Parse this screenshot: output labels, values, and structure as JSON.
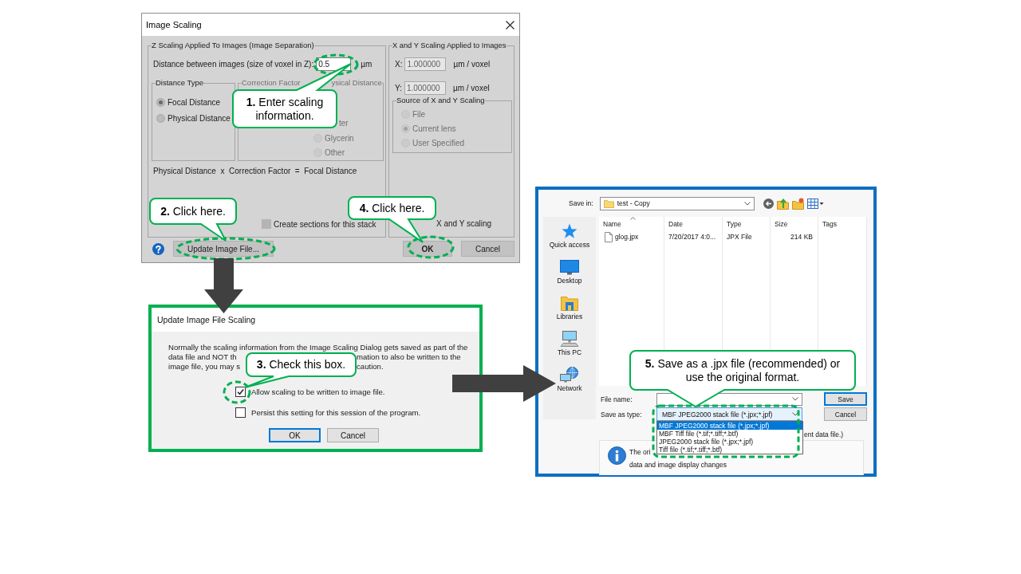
{
  "image_scaling_dialog": {
    "title": "Image Scaling",
    "z_scaling": {
      "legend": "Z Scaling Applied To Images (Image Separation)",
      "distance_label": "Distance between images (size of voxel in Z):",
      "distance_value": "0.5",
      "distance_unit": "µm",
      "distance_type": {
        "legend": "Distance Type",
        "options": [
          {
            "label": "Focal Distance",
            "selected": true,
            "disabled": false
          },
          {
            "label": "Physical Distance",
            "selected": false,
            "disabled": false
          }
        ]
      },
      "correction_factor": {
        "legend_parts": [
          "Correction Factor",
          "ysical Distance"
        ],
        "disabled": true,
        "covered_option_label": "ter",
        "options": [
          {
            "label": "Glycerin",
            "selected": false,
            "disabled": true
          },
          {
            "label": "Other",
            "selected": false,
            "disabled": true
          }
        ]
      },
      "formula": "Physical Distance  x  Correction Factor  =  Focal Distance",
      "create_sections": {
        "label": "Create sections for this stack",
        "checked": false
      }
    },
    "xy_scaling": {
      "legend": "X and Y Scaling Applied to Images",
      "fields": [
        {
          "label": "X:",
          "value": "1.000000",
          "unit": "µm / voxel"
        },
        {
          "label": "Y:",
          "value": "1.000000",
          "unit": "µm / voxel"
        }
      ],
      "source": {
        "legend": "Source of X and Y Scaling",
        "options": [
          {
            "label": "File",
            "selected": false,
            "disabled": true
          },
          {
            "label": "Current lens",
            "selected": true,
            "disabled": true
          },
          {
            "label": "User Specified",
            "selected": false,
            "disabled": true
          }
        ]
      },
      "partial_checkbox_label": "X and Y scaling"
    },
    "buttons": [
      {
        "label": "Update Image File...",
        "default": false
      },
      {
        "label": "OK",
        "default": true
      },
      {
        "label": "Cancel",
        "default": false
      }
    ]
  },
  "update_file_dialog": {
    "title": "Update Image File Scaling",
    "message_lines": [
      {
        "left": "Normally the scaling information from the Image Scaling Dialog gets saved as part of the"
      },
      {
        "left": "data file and NOT th",
        "right": "mation to also be written to the"
      },
      {
        "left": "image file, you may s",
        "right": "caution."
      }
    ],
    "checkboxes": [
      {
        "label": "Allow scaling to be written to image file.",
        "checked": true
      },
      {
        "label": "Persist this setting for this session of the program.",
        "checked": false
      }
    ],
    "buttons": [
      {
        "label": "OK",
        "default": true
      },
      {
        "label": "Cancel",
        "default": false
      }
    ]
  },
  "save_dialog": {
    "save_in_label": "Save in:",
    "save_in_value": "test - Copy",
    "places": [
      "Quick access",
      "Desktop",
      "Libraries",
      "This PC",
      "Network"
    ],
    "columns": [
      "Name",
      "Date",
      "Type",
      "Size",
      "Tags"
    ],
    "files": [
      {
        "name": "glog.jpx",
        "date": "7/20/2017 4:0...",
        "type": "JPX File",
        "size": "214 KB"
      }
    ],
    "file_name_label": "File name:",
    "save_type_label": "Save as type:",
    "save_type_value": "MBF JPEG2000 stack file (*.jpx;*.jpf)",
    "type_options": [
      {
        "label": "MBF JPEG2000 stack file (*.jpx;*.jpf)",
        "selected": true
      },
      {
        "label": "MBF Tiff file (*.tif;*.tiff;*.btf)",
        "selected": false
      },
      {
        "label": "JPEG2000 stack file (*.jpx;*.jpf)",
        "selected": false
      },
      {
        "label": "Tiff file (*.tif;*.tiff;*.btf)",
        "selected": false
      }
    ],
    "buttons": [
      {
        "label": "Save",
        "default": true
      },
      {
        "label": "Cancel",
        "default": false
      }
    ],
    "note_fragment": "ent data file.)",
    "info_fragments": [
      "The ori",
      "data and image display changes"
    ]
  },
  "callouts": [
    {
      "text": "**1.** Enter scaling information."
    },
    {
      "text": "**2.** Click here."
    },
    {
      "text": "**3.** Check this box."
    },
    {
      "text": "**4.** Click here."
    },
    {
      "text": "**5.** Save as a .jpx file (recommended) or use the original format."
    }
  ]
}
